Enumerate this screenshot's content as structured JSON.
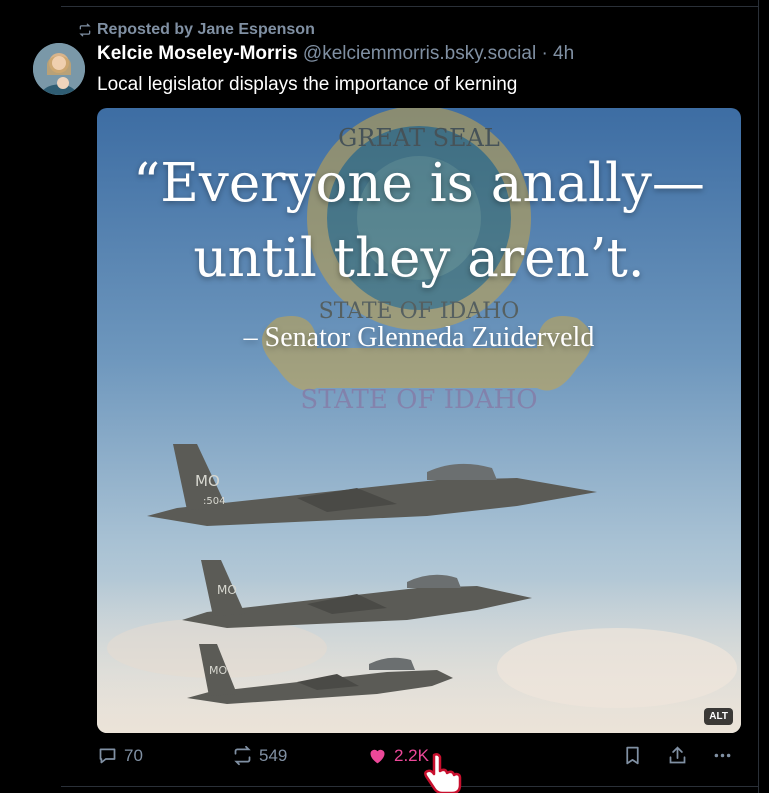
{
  "repost": {
    "label": "Reposted by Jane Espenson",
    "icon": "repost-icon"
  },
  "post": {
    "author_name": "Kelcie Moseley-Morris",
    "author_handle": "@kelciemmorris.bsky.social · 4h",
    "text": "Local legislator displays the importance of kerning",
    "avatar_icon": "avatar"
  },
  "media": {
    "quote_line1": "“Everyone is anally—",
    "quote_line2": "until they aren’t.",
    "attribution": "– Senator Glenneda Zuiderveld",
    "seal_text_top": "GREAT SEAL",
    "seal_text_bottom": "STATE OF IDAHO",
    "banner_text": "STATE OF IDAHO",
    "jet_marking": "MO",
    "jet_number": ":504",
    "alt_badge": "ALT"
  },
  "actions": {
    "reply_count": "70",
    "repost_count": "549",
    "like_count": "2.2K",
    "like_color": "#ec4899"
  },
  "colors": {
    "background": "#000000",
    "muted": "#8090a3",
    "like": "#ec4899"
  }
}
